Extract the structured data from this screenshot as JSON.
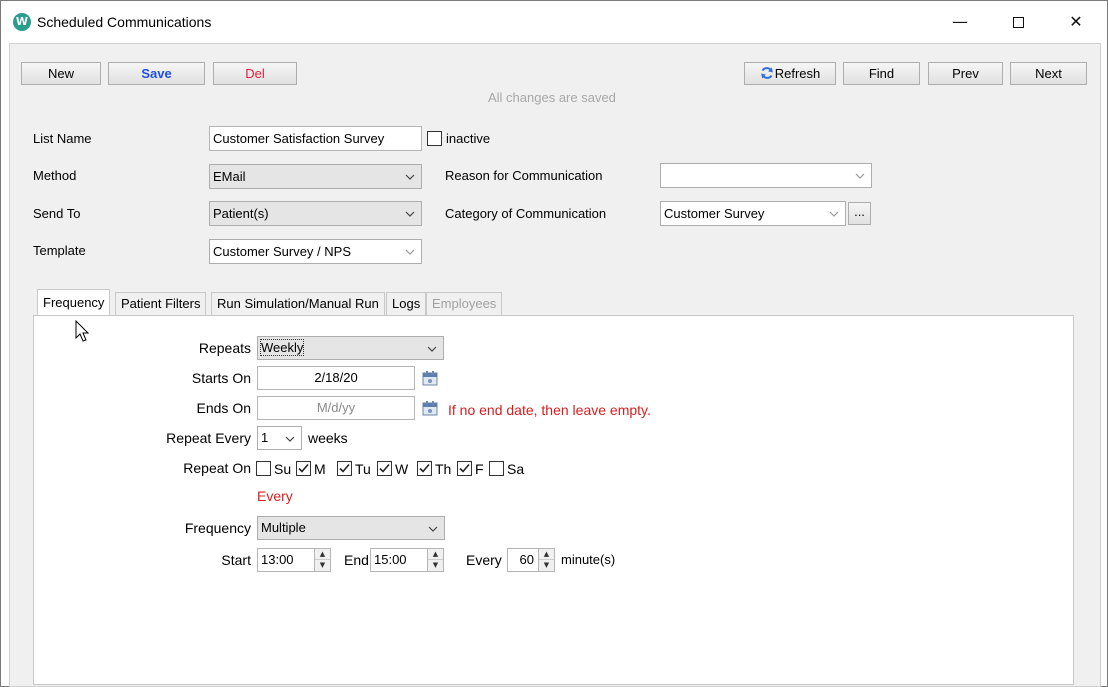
{
  "window": {
    "title": "Scheduled Communications",
    "app_icon_letter": "W",
    "minimize_glyph": "—",
    "close_glyph": "✕"
  },
  "toolbar": {
    "new_label": "New",
    "save_label": "Save",
    "del_label": "Del",
    "refresh_label": "Refresh",
    "find_label": "Find",
    "prev_label": "Prev",
    "next_label": "Next",
    "status_text": "All changes are saved"
  },
  "form": {
    "list_name_label": "List Name",
    "list_name_value": "Customer Satisfaction Survey",
    "inactive_label": "inactive",
    "inactive_checked": false,
    "method_label": "Method",
    "method_value": "EMail",
    "send_to_label": "Send To",
    "send_to_value": "Patient(s)",
    "template_label": "Template",
    "template_value": "Customer Survey / NPS",
    "reason_label": "Reason for Communication",
    "reason_value": "",
    "category_label": "Category of Communication",
    "category_value": "Customer Survey",
    "category_more_label": "..."
  },
  "tabs": [
    {
      "label": "Frequency",
      "active": true,
      "disabled": false
    },
    {
      "label": "Patient Filters",
      "active": false,
      "disabled": false
    },
    {
      "label": "Run Simulation/Manual Run",
      "active": false,
      "disabled": false
    },
    {
      "label": "Logs",
      "active": false,
      "disabled": false
    },
    {
      "label": "Employees",
      "active": false,
      "disabled": true
    }
  ],
  "frequency": {
    "repeats_label": "Repeats",
    "repeats_value": "Weekly",
    "starts_on_label": "Starts On",
    "starts_on_value": "2/18/20",
    "ends_on_label": "Ends On",
    "ends_on_placeholder": "M/d/yy",
    "ends_on_hint": "If no end date, then leave empty.",
    "repeat_every_label": "Repeat Every",
    "repeat_every_value": "1",
    "repeat_every_unit": "weeks",
    "repeat_on_label": "Repeat On",
    "days": [
      {
        "label": "Su",
        "checked": false
      },
      {
        "label": "M",
        "checked": true
      },
      {
        "label": "Tu",
        "checked": true
      },
      {
        "label": "W",
        "checked": true
      },
      {
        "label": "Th",
        "checked": true
      },
      {
        "label": "F",
        "checked": true
      },
      {
        "label": "Sa",
        "checked": false
      }
    ],
    "every_text": "Every",
    "frequency_label": "Frequency",
    "frequency_value": "Multiple",
    "start_label": "Start",
    "start_value": "13:00",
    "end_label": "End",
    "end_value": "15:00",
    "every_label": "Every",
    "every_value": "60",
    "every_unit": "minute(s)"
  },
  "colors": {
    "save_text": "#1f4fe0",
    "del_text": "#e0203a",
    "hint_red": "#d42020",
    "status_gray": "#a7a7a7"
  },
  "icons": {
    "refresh": "refresh-icon",
    "calendar": "calendar-icon",
    "chevron": "chevron-down-icon",
    "checkmark": "checkmark-icon",
    "cursor": "mouse-cursor-icon"
  }
}
